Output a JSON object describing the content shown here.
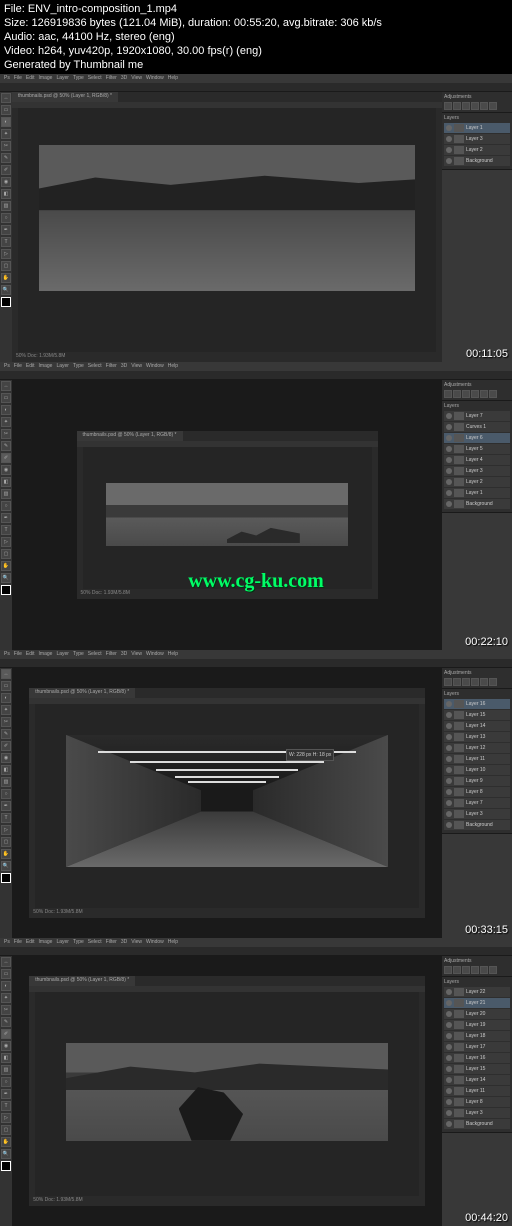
{
  "meta": {
    "file": "File: ENV_intro-composition_1.mp4",
    "size": "Size: 126919836 bytes (121.04 MiB), duration: 00:55:20, avg.bitrate: 306 kb/s",
    "audio": "Audio: aac, 44100 Hz, stereo (eng)",
    "video": "Video: h264, yuv420p, 1920x1080, 30.00 fps(r) (eng)",
    "gen": "Generated by Thumbnail me"
  },
  "watermark": "www.cg-ku.com",
  "ps": {
    "menus": [
      "Ps",
      "File",
      "Edit",
      "Image",
      "Layer",
      "Type",
      "Select",
      "Filter",
      "3D",
      "View",
      "Window",
      "Help"
    ],
    "doc_tab": "thumbnails.psd @ 50% (Layer 1, RGB/8) *",
    "status": "50%    Doc: 1.93M/5.8M"
  },
  "frames": [
    {
      "timestamp": "00:11:05",
      "layers": [
        "Layer 1",
        "Layer 3",
        "Layer 2",
        "Background"
      ]
    },
    {
      "timestamp": "00:22:10",
      "layers": [
        "Layer 7",
        "Curves 1",
        "Layer 6",
        "Layer 5",
        "Layer 4",
        "Layer 3",
        "Layer 2",
        "Layer 1",
        "Background"
      ]
    },
    {
      "timestamp": "00:33:15",
      "layers": [
        "Layer 16",
        "Layer 15",
        "Layer 14",
        "Layer 13",
        "Layer 12",
        "Layer 11",
        "Layer 10",
        "Layer 9",
        "Layer 8",
        "Layer 7",
        "Layer 3",
        "Background"
      ],
      "tooltip": "W: 228 px\nH: 18 px"
    },
    {
      "timestamp": "00:44:20",
      "layers": [
        "Layer 22",
        "Layer 21",
        "Layer 20",
        "Layer 19",
        "Layer 18",
        "Layer 17",
        "Layer 16",
        "Layer 15",
        "Layer 14",
        "Layer 11",
        "Layer 8",
        "Layer 3",
        "Background"
      ]
    }
  ],
  "panels": {
    "adjustments": "Adjustments",
    "layers": "Layers"
  }
}
